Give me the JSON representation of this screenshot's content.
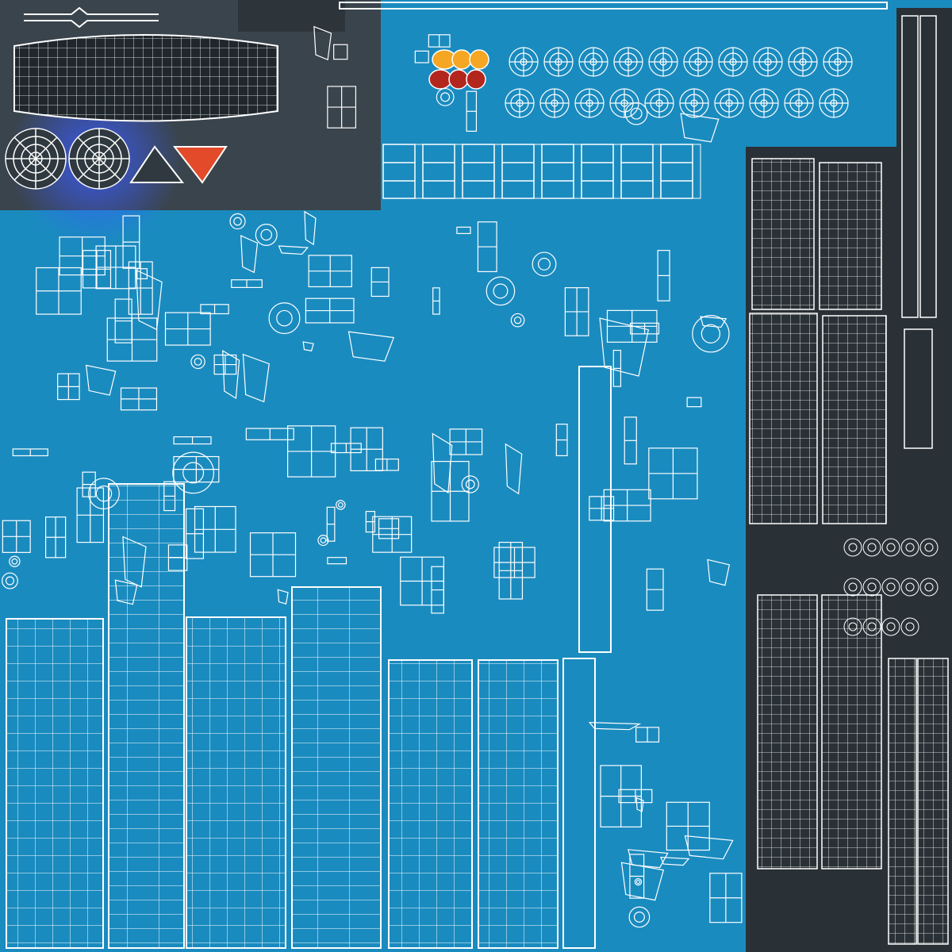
{
  "colors": {
    "background_blue": "#1a8bbf",
    "background_dark": "#2a3136",
    "background_gray": "#3a444c",
    "glow_blue": "#2452e0",
    "wireframe": "#ffffff",
    "fill_red": "#e24a2a",
    "fill_orange": "#f5a623",
    "fill_dark_red": "#b3261e"
  },
  "icons": {
    "headlight": "headlight-icon",
    "taillight": "taillight-icon",
    "wheel": "wheel-icon",
    "brake_disc": "brake-disc-icon"
  }
}
